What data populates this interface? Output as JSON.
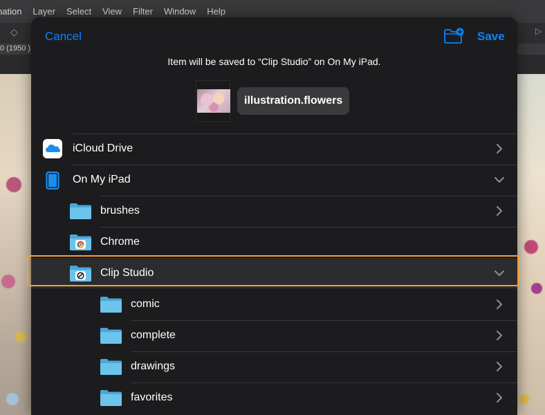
{
  "background_app": {
    "menu": [
      "nation",
      "Layer",
      "Select",
      "View",
      "Filter",
      "Window",
      "Help"
    ],
    "ruler_text": "0 (1950 )"
  },
  "sheet": {
    "cancel_label": "Cancel",
    "save_label": "Save",
    "subtitle": "Item will be saved to “Clip Studio” on On My iPad.",
    "filename": "illustration.flowers"
  },
  "locations": [
    {
      "label": "iCloud Drive",
      "icon": "icloud-icon",
      "chevron": "right",
      "indent": 0
    },
    {
      "label": "On My iPad",
      "icon": "ipad-icon",
      "chevron": "down",
      "indent": 0
    },
    {
      "label": "brushes",
      "icon": "folder-icon",
      "chevron": "right",
      "indent": 1
    },
    {
      "label": "Chrome",
      "icon": "chrome-folder-icon",
      "chevron": "",
      "indent": 1
    },
    {
      "label": "Clip Studio",
      "icon": "clip-studio-folder-icon",
      "chevron": "down",
      "indent": 1,
      "selected": true
    },
    {
      "label": "comic",
      "icon": "folder-icon",
      "chevron": "right",
      "indent": 2
    },
    {
      "label": "complete",
      "icon": "folder-icon",
      "chevron": "right",
      "indent": 2
    },
    {
      "label": "drawings",
      "icon": "folder-icon",
      "chevron": "right",
      "indent": 2
    },
    {
      "label": "favorites",
      "icon": "folder-icon",
      "chevron": "right",
      "indent": 2
    }
  ],
  "colors": {
    "accent": "#0a84ff",
    "selection_outline": "#f2a23b",
    "sheet_bg": "#1c1c1e",
    "folder_blue": "#5ab8e6"
  }
}
